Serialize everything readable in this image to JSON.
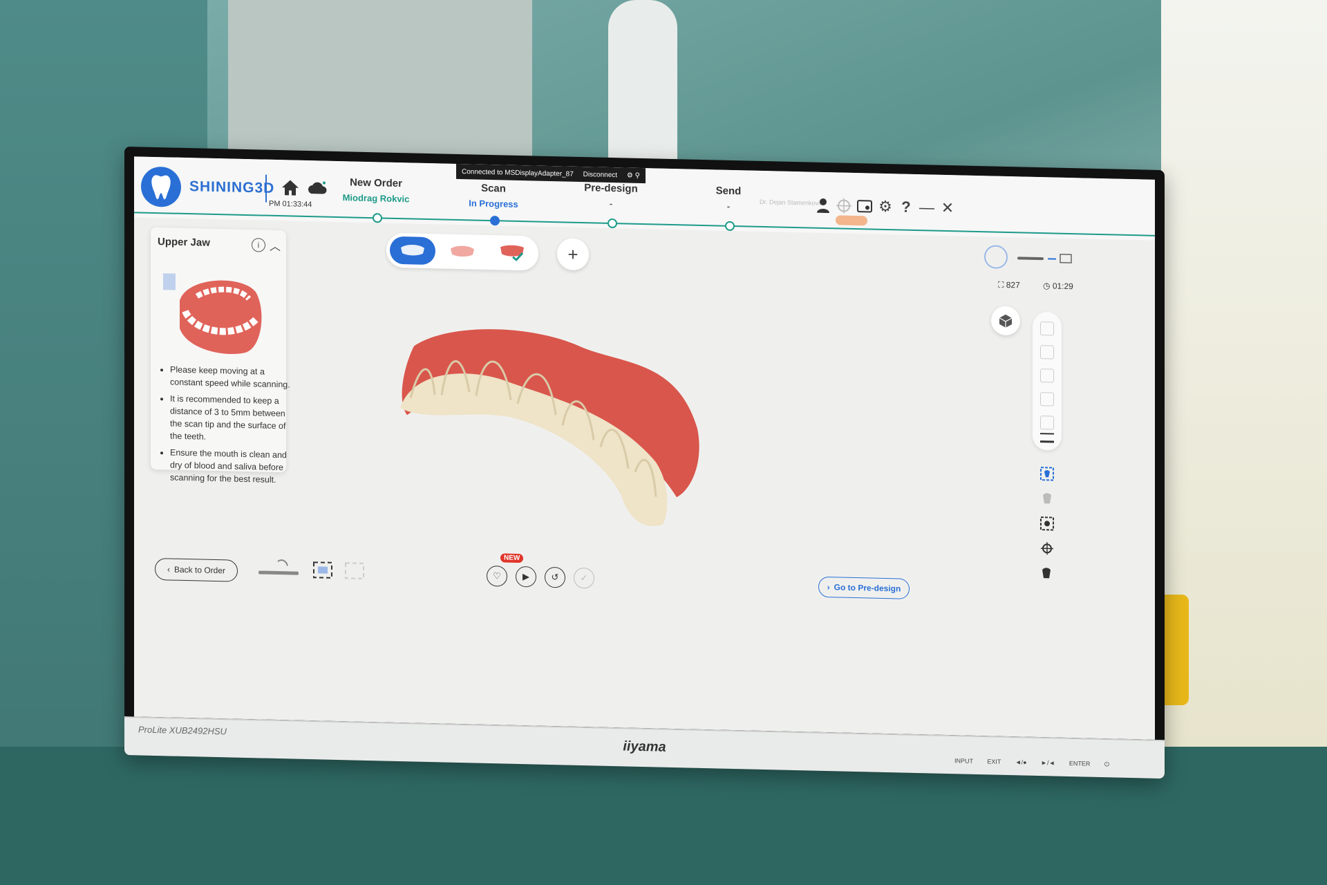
{
  "app": {
    "brand": "SHINING3D",
    "clock": "PM 01:33:44",
    "connection_bar": {
      "text": "Connected to MSDisplayAdapter_87",
      "disconnect_label": "Disconnect"
    },
    "user_name": "Dr. Dejan Stamenkovic"
  },
  "steps": [
    {
      "title": "New Order",
      "sub": "Miodrag Rokvic",
      "sub_color": "#1d9a8a"
    },
    {
      "title": "Scan",
      "sub": "In Progress",
      "sub_color": "#2a6fd6"
    },
    {
      "title": "Pre-design",
      "sub": "-",
      "sub_color": "#555555"
    },
    {
      "title": "Send",
      "sub": "-",
      "sub_color": "#555555"
    }
  ],
  "left_panel": {
    "title": "Upper Jaw",
    "tips": [
      "Please keep moving at a constant speed while scanning.",
      "It is recommended to keep a distance of 3 to 5mm between the scan tip and the surface of the teeth.",
      "Ensure the mouth is clean and dry of blood and saliva before scanning for the best result."
    ]
  },
  "stats": {
    "frame_count": "827",
    "elapsed": "01:29"
  },
  "bottom": {
    "back_label": "Back to Order",
    "new_badge": "NEW",
    "next_label": "Go to Pre-design"
  },
  "monitor": {
    "model": "ProLite XUB2492HSU",
    "brand": "iiyama",
    "controls": "INPUT EXIT ◄/● ►/◄ ENTER ⏻"
  },
  "colors": {
    "accent": "#2a6fd6",
    "progress": "#1d9a8a",
    "gum": "#e0635a"
  }
}
